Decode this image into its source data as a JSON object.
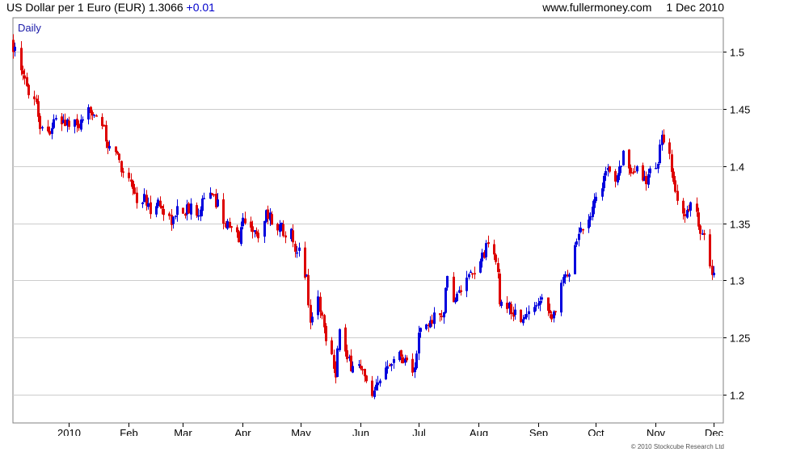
{
  "header": {
    "title": "US Dollar per 1 Euro (EUR)",
    "last": "1.3066",
    "change": "+0.01",
    "site": "www.fullermoney.com",
    "date": "1 Dec 2010"
  },
  "copyright": "© 2010 Stockcube Research Ltd",
  "colors": {
    "up": "#0000dd",
    "down": "#dd0000",
    "grid": "#cccccc"
  },
  "chart_data": {
    "type": "candlestick",
    "title": "US Dollar per 1 Euro (EUR)",
    "period_label": "Daily",
    "ylim": [
      1.175,
      1.53
    ],
    "yticks": [
      1.2,
      1.25,
      1.3,
      1.35,
      1.4,
      1.45,
      1.5
    ],
    "ytick_labels": [
      "1.2",
      "1.25",
      "1.3",
      "1.35",
      "1.4",
      "1.45",
      "1.5"
    ],
    "xticks": [
      {
        "label": "2010",
        "date": "2010-01-01"
      },
      {
        "label": "Feb",
        "date": "2010-02-01"
      },
      {
        "label": "Mar",
        "date": "2010-03-01"
      },
      {
        "label": "Apr",
        "date": "2010-04-01"
      },
      {
        "label": "May",
        "date": "2010-05-01"
      },
      {
        "label": "Jun",
        "date": "2010-06-01"
      },
      {
        "label": "Jul",
        "date": "2010-07-01"
      },
      {
        "label": "Aug",
        "date": "2010-08-01"
      },
      {
        "label": "Sep",
        "date": "2010-09-01"
      },
      {
        "label": "Oct",
        "date": "2010-10-01"
      },
      {
        "label": "Nov",
        "date": "2010-11-01"
      },
      {
        "label": "Dec",
        "date": "2010-12-01"
      }
    ],
    "xlim": [
      "2009-12-03",
      "2010-12-06"
    ],
    "start_date": "2009-12-03",
    "end_date": "2010-12-01",
    "grid": true,
    "path": [
      [
        "2009-12-03",
        1.506
      ],
      [
        "2009-12-07",
        1.48
      ],
      [
        "2009-12-10",
        1.471
      ],
      [
        "2009-12-15",
        1.457
      ],
      [
        "2009-12-17",
        1.436
      ],
      [
        "2009-12-21",
        1.43
      ],
      [
        "2009-12-24",
        1.438
      ],
      [
        "2009-12-29",
        1.439
      ],
      [
        "2010-01-04",
        1.435
      ],
      [
        "2010-01-08",
        1.435
      ],
      [
        "2010-01-12",
        1.45
      ],
      [
        "2010-01-14",
        1.449
      ],
      [
        "2010-01-18",
        1.437
      ],
      [
        "2010-01-21",
        1.414
      ],
      [
        "2010-01-25",
        1.415
      ],
      [
        "2010-01-28",
        1.398
      ],
      [
        "2010-02-02",
        1.39
      ],
      [
        "2010-02-05",
        1.368
      ],
      [
        "2010-02-09",
        1.372
      ],
      [
        "2010-02-11",
        1.362
      ],
      [
        "2010-02-16",
        1.368
      ],
      [
        "2010-02-19",
        1.36
      ],
      [
        "2010-02-24",
        1.352
      ],
      [
        "2010-02-26",
        1.362
      ],
      [
        "2010-03-03",
        1.362
      ],
      [
        "2010-03-05",
        1.362
      ],
      [
        "2010-03-09",
        1.362
      ],
      [
        "2010-03-12",
        1.376
      ],
      [
        "2010-03-16",
        1.372
      ],
      [
        "2010-03-19",
        1.368
      ],
      [
        "2010-03-23",
        1.35
      ],
      [
        "2010-03-26",
        1.343
      ],
      [
        "2010-03-30",
        1.338
      ],
      [
        "2010-04-01",
        1.352
      ],
      [
        "2010-04-05",
        1.35
      ],
      [
        "2010-04-08",
        1.337
      ],
      [
        "2010-04-13",
        1.36
      ],
      [
        "2010-04-16",
        1.352
      ],
      [
        "2010-04-20",
        1.347
      ],
      [
        "2010-04-26",
        1.34
      ],
      [
        "2010-04-28",
        1.32
      ],
      [
        "2010-04-30",
        1.325
      ],
      [
        "2010-05-04",
        1.302
      ],
      [
        "2010-05-06",
        1.263
      ],
      [
        "2010-05-10",
        1.285
      ],
      [
        "2010-05-13",
        1.258
      ],
      [
        "2010-05-17",
        1.235
      ],
      [
        "2010-05-19",
        1.22
      ],
      [
        "2010-05-21",
        1.258
      ],
      [
        "2010-05-25",
        1.228
      ],
      [
        "2010-05-28",
        1.225
      ],
      [
        "2010-06-01",
        1.225
      ],
      [
        "2010-06-03",
        1.213
      ],
      [
        "2010-06-07",
        1.195
      ],
      [
        "2010-06-11",
        1.212
      ],
      [
        "2010-06-15",
        1.23
      ],
      [
        "2010-06-21",
        1.235
      ],
      [
        "2010-06-24",
        1.232
      ],
      [
        "2010-06-29",
        1.22
      ],
      [
        "2010-07-01",
        1.253
      ],
      [
        "2010-07-06",
        1.261
      ],
      [
        "2010-07-09",
        1.268
      ],
      [
        "2010-07-13",
        1.267
      ],
      [
        "2010-07-16",
        1.298
      ],
      [
        "2010-07-20",
        1.282
      ],
      [
        "2010-07-23",
        1.292
      ],
      [
        "2010-07-27",
        1.3
      ],
      [
        "2010-07-30",
        1.305
      ],
      [
        "2010-08-03",
        1.322
      ],
      [
        "2010-08-06",
        1.33
      ],
      [
        "2010-08-10",
        1.32
      ],
      [
        "2010-08-12",
        1.283
      ],
      [
        "2010-08-16",
        1.278
      ],
      [
        "2010-08-20",
        1.27
      ],
      [
        "2010-08-24",
        1.265
      ],
      [
        "2010-08-27",
        1.27
      ],
      [
        "2010-09-01",
        1.283
      ],
      [
        "2010-09-03",
        1.29
      ],
      [
        "2010-09-07",
        1.27
      ],
      [
        "2010-09-10",
        1.275
      ],
      [
        "2010-09-14",
        1.3
      ],
      [
        "2010-09-17",
        1.31
      ],
      [
        "2010-09-20",
        1.333
      ],
      [
        "2010-09-23",
        1.345
      ],
      [
        "2010-09-28",
        1.36
      ],
      [
        "2010-10-01",
        1.374
      ],
      [
        "2010-10-06",
        1.393
      ],
      [
        "2010-10-11",
        1.392
      ],
      [
        "2010-10-15",
        1.41
      ],
      [
        "2010-10-19",
        1.388
      ],
      [
        "2010-10-22",
        1.396
      ],
      [
        "2010-10-26",
        1.388
      ],
      [
        "2010-10-29",
        1.393
      ],
      [
        "2010-11-02",
        1.406
      ],
      [
        "2010-11-04",
        1.425
      ],
      [
        "2010-11-08",
        1.405
      ],
      [
        "2010-11-10",
        1.382
      ],
      [
        "2010-11-12",
        1.372
      ],
      [
        "2010-11-16",
        1.356
      ],
      [
        "2010-11-19",
        1.368
      ],
      [
        "2010-11-23",
        1.352
      ],
      [
        "2010-11-26",
        1.336
      ],
      [
        "2010-11-29",
        1.31
      ],
      [
        "2010-12-01",
        1.3066
      ]
    ]
  }
}
